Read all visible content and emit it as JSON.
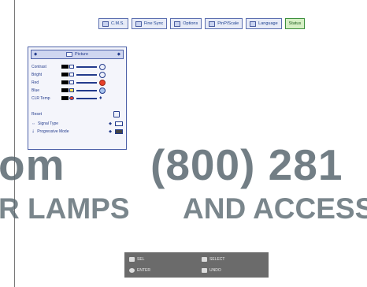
{
  "menu": {
    "items": [
      {
        "label": "C.M.S.",
        "active": false
      },
      {
        "label": "Fine Sync",
        "active": false
      },
      {
        "label": "Options",
        "active": false
      },
      {
        "label": "PinP/Scale",
        "active": false
      },
      {
        "label": "Language",
        "active": false
      },
      {
        "label": "Status",
        "active": true
      }
    ]
  },
  "panel": {
    "title": "Picture",
    "rows": [
      {
        "label": "Contrast"
      },
      {
        "label": "Bright"
      },
      {
        "label": "Red"
      },
      {
        "label": "Blue"
      },
      {
        "label": "CLR Temp"
      },
      {
        "label": "Reset"
      },
      {
        "label": "Signal Type"
      },
      {
        "label": "Progressive Mode"
      }
    ]
  },
  "watermark": {
    "line1_left": "om",
    "line1_right": "(800) 281",
    "line2_left": "R LAMPS",
    "line2_right": "AND ACCESS"
  },
  "guide": {
    "items": [
      "SEL",
      "ENTER",
      "SELECT",
      "UNDO"
    ]
  },
  "colors": {
    "accent": "#4c60a8",
    "status_active": "#3d8f3d",
    "guide_bg": "#6b6b6b"
  }
}
